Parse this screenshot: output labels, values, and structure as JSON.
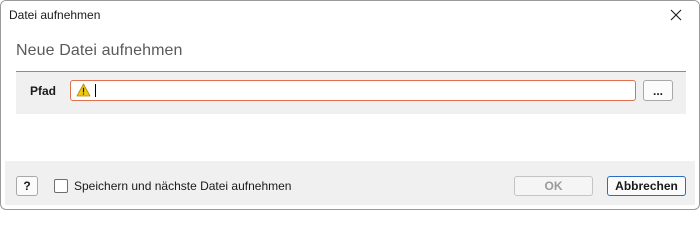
{
  "window": {
    "title": "Datei aufnehmen",
    "close_icon": "close-icon"
  },
  "main": {
    "heading": "Neue Datei aufnehmen",
    "path_field": {
      "label": "Pfad",
      "value": "",
      "placeholder": "",
      "status_icon": "warning-icon",
      "status": "invalid"
    },
    "browse_label": "..."
  },
  "footer": {
    "help_label": "?",
    "checkbox": {
      "label": "Speichern und nächste Datei aufnehmen",
      "checked": false
    },
    "ok_label": "OK",
    "ok_enabled": false,
    "cancel_label": "Abbrechen"
  },
  "colors": {
    "invalid_border": "#e0704f",
    "warning_fill": "#f2c811",
    "default_button_border": "#2b6cc4",
    "footer_bg": "#f0f0f0"
  }
}
